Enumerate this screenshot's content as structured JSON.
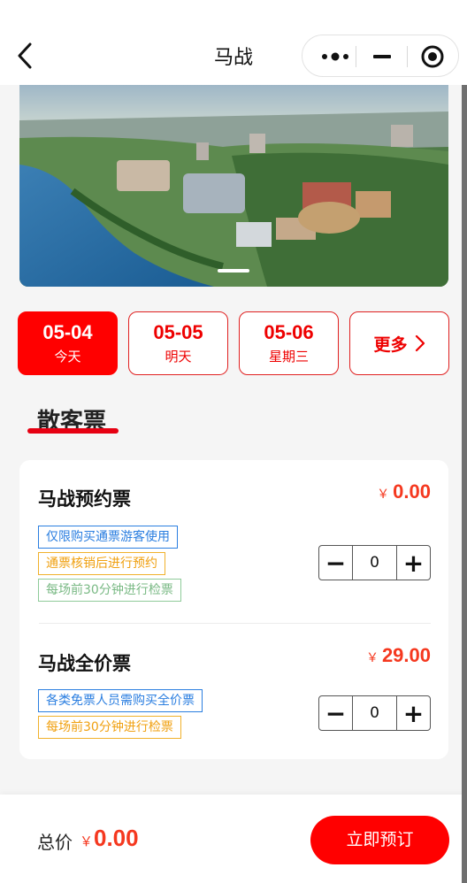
{
  "nav": {
    "title": "马战"
  },
  "dates": [
    {
      "date": "05-04",
      "label": "今天",
      "active": true
    },
    {
      "date": "05-05",
      "label": "明天",
      "active": false
    },
    {
      "date": "05-06",
      "label": "星期三",
      "active": false
    }
  ],
  "more_label": "更多",
  "section_title": "散客票",
  "tickets": [
    {
      "name": "马战预约票",
      "currency": "￥",
      "price": "0.00",
      "tags": [
        {
          "text": "仅限购买通票游客使用",
          "color": "blue"
        },
        {
          "text": "通票核销后进行预约",
          "color": "orange"
        },
        {
          "text": "每场前30分钟进行检票",
          "color": "green"
        }
      ],
      "quantity": "0"
    },
    {
      "name": "马战全价票",
      "currency": "￥",
      "price": "29.00",
      "tags": [
        {
          "text": "各类免票人员需购买全价票",
          "color": "blue"
        },
        {
          "text": "每场前30分钟进行检票",
          "color": "orange"
        }
      ],
      "quantity": "0"
    }
  ],
  "stepper": {
    "minus": "−",
    "plus": "+"
  },
  "footer": {
    "total_label": "总价",
    "currency": "￥",
    "total": "0.00",
    "book_label": "立即预订"
  },
  "colors": {
    "accent": "#ff0000",
    "price": "#f5381f",
    "tag_blue": "#2a7ee0",
    "tag_orange": "#f0b12b",
    "tag_green": "#8fcb99"
  },
  "icons": {
    "back": "chevron-left-icon",
    "menu": "more-dots-icon",
    "minimize": "minimize-icon",
    "close": "target-circle-icon",
    "more": "chevron-right-icon"
  }
}
